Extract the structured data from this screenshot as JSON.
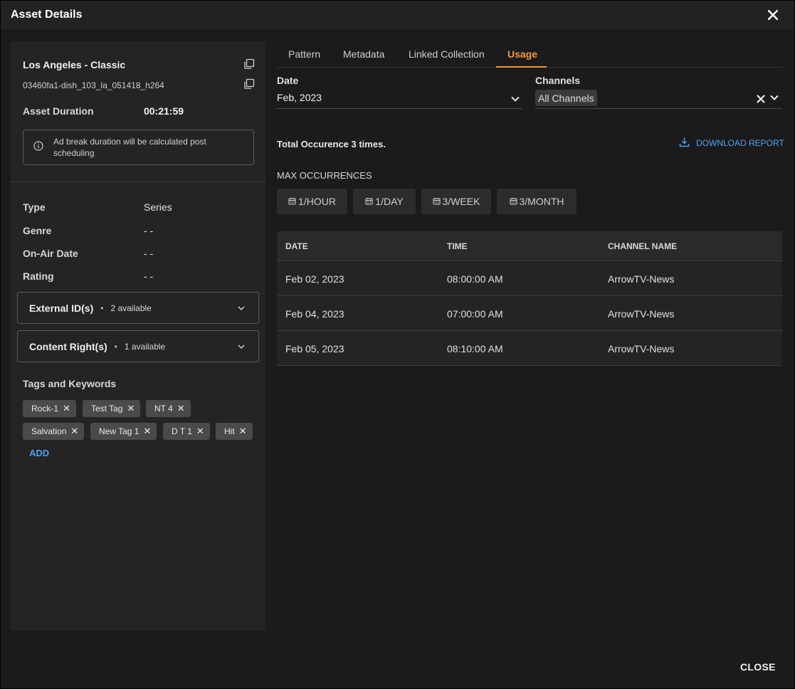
{
  "dialog": {
    "title": "Asset Details",
    "close_label": "CLOSE"
  },
  "asset": {
    "name": "Los Angeles - Classic",
    "id": "03460fa1-dish_103_la_051418_h264",
    "duration_label": "Asset Duration",
    "duration_value": "00:21:59",
    "info_text": "Ad break duration will be calculated post scheduling"
  },
  "properties": [
    {
      "label": "Type",
      "value": "Series"
    },
    {
      "label": "Genre",
      "value": "- -"
    },
    {
      "label": "On-Air Date",
      "value": "- -"
    },
    {
      "label": "Rating",
      "value": "- -"
    }
  ],
  "accordions": [
    {
      "title": "External ID(s)",
      "count": "2 available"
    },
    {
      "title": "Content Right(s)",
      "count": "1 available"
    }
  ],
  "tags": {
    "title": "Tags and Keywords",
    "items": [
      "Rock-1",
      "Test Tag",
      "NT 4",
      "Salvation",
      "New Tag 1",
      "D T 1",
      "Hit"
    ],
    "add_label": "ADD"
  },
  "tabs": [
    {
      "label": "Pattern",
      "active": false
    },
    {
      "label": "Metadata",
      "active": false
    },
    {
      "label": "Linked Collection",
      "active": false
    },
    {
      "label": "Usage",
      "active": true
    }
  ],
  "filters": {
    "date_label": "Date",
    "date_value": "Feb, 2023",
    "channels_label": "Channels",
    "channels_value": "All Channels"
  },
  "usage": {
    "total_text": "Total Occurence 3 times.",
    "download_label": "DOWNLOAD REPORT",
    "max_title": "MAX OCCURRENCES",
    "frequencies": [
      "1/HOUR",
      "1/DAY",
      "3/WEEK",
      "3/MONTH"
    ]
  },
  "table": {
    "headers": [
      "DATE",
      "TIME",
      "CHANNEL NAME"
    ],
    "rows": [
      [
        "Feb 02, 2023",
        "08:00:00 AM",
        "ArrowTV-News"
      ],
      [
        "Feb 04, 2023",
        "07:00:00 AM",
        "ArrowTV-News"
      ],
      [
        "Feb 05, 2023",
        "08:10:00 AM",
        "ArrowTV-News"
      ]
    ]
  },
  "colors": {
    "accent": "#f39a3f",
    "link": "#4aa3f0",
    "background": "#1b1b1b"
  }
}
